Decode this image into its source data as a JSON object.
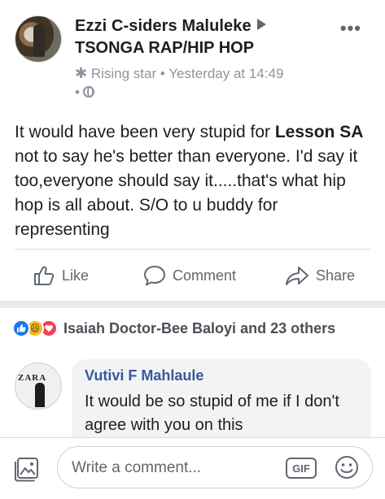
{
  "post": {
    "author": "Ezzi C-siders Maluleke",
    "group": "TSONGA RAP/HIP HOP",
    "badge_label": "Rising star",
    "separator": "•",
    "timestamp": "Yesterday at 14:49",
    "globe_prefix": "•",
    "more_label": "•••",
    "body_before_mention": "It would have been very stupid for ",
    "mention": "Lesson SA",
    "body_after_mention": " not to say he's better than everyone. I'd say it too,everyone should say it.....that's what hip hop is all about. S/O to u buddy for representing"
  },
  "actions": {
    "like_label": "Like",
    "comment_label": "Comment",
    "share_label": "Share"
  },
  "reactions": {
    "summary": "Isaiah Doctor-Bee Baloyi and 23 others",
    "haha_glyph": "😆"
  },
  "comment": {
    "avatar_text": "ZARA",
    "author": "Vutivi F Mahlaule",
    "text": "It would be so stupid of me if I don't agree with you on this"
  },
  "composer": {
    "placeholder": "Write a comment...",
    "gif_label": "GIF"
  },
  "colors": {
    "accent": "#1877f2",
    "name_link": "#385898",
    "meta_gray": "#8d949e",
    "separator_bg": "#e9ebee"
  },
  "icons": [
    "arrow-right-icon",
    "star-icon",
    "globe-icon",
    "more-icon",
    "like-icon",
    "comment-icon",
    "share-icon",
    "like-reaction-icon",
    "haha-reaction-icon",
    "love-reaction-icon",
    "photo-icon",
    "gif-icon",
    "emoji-icon"
  ]
}
